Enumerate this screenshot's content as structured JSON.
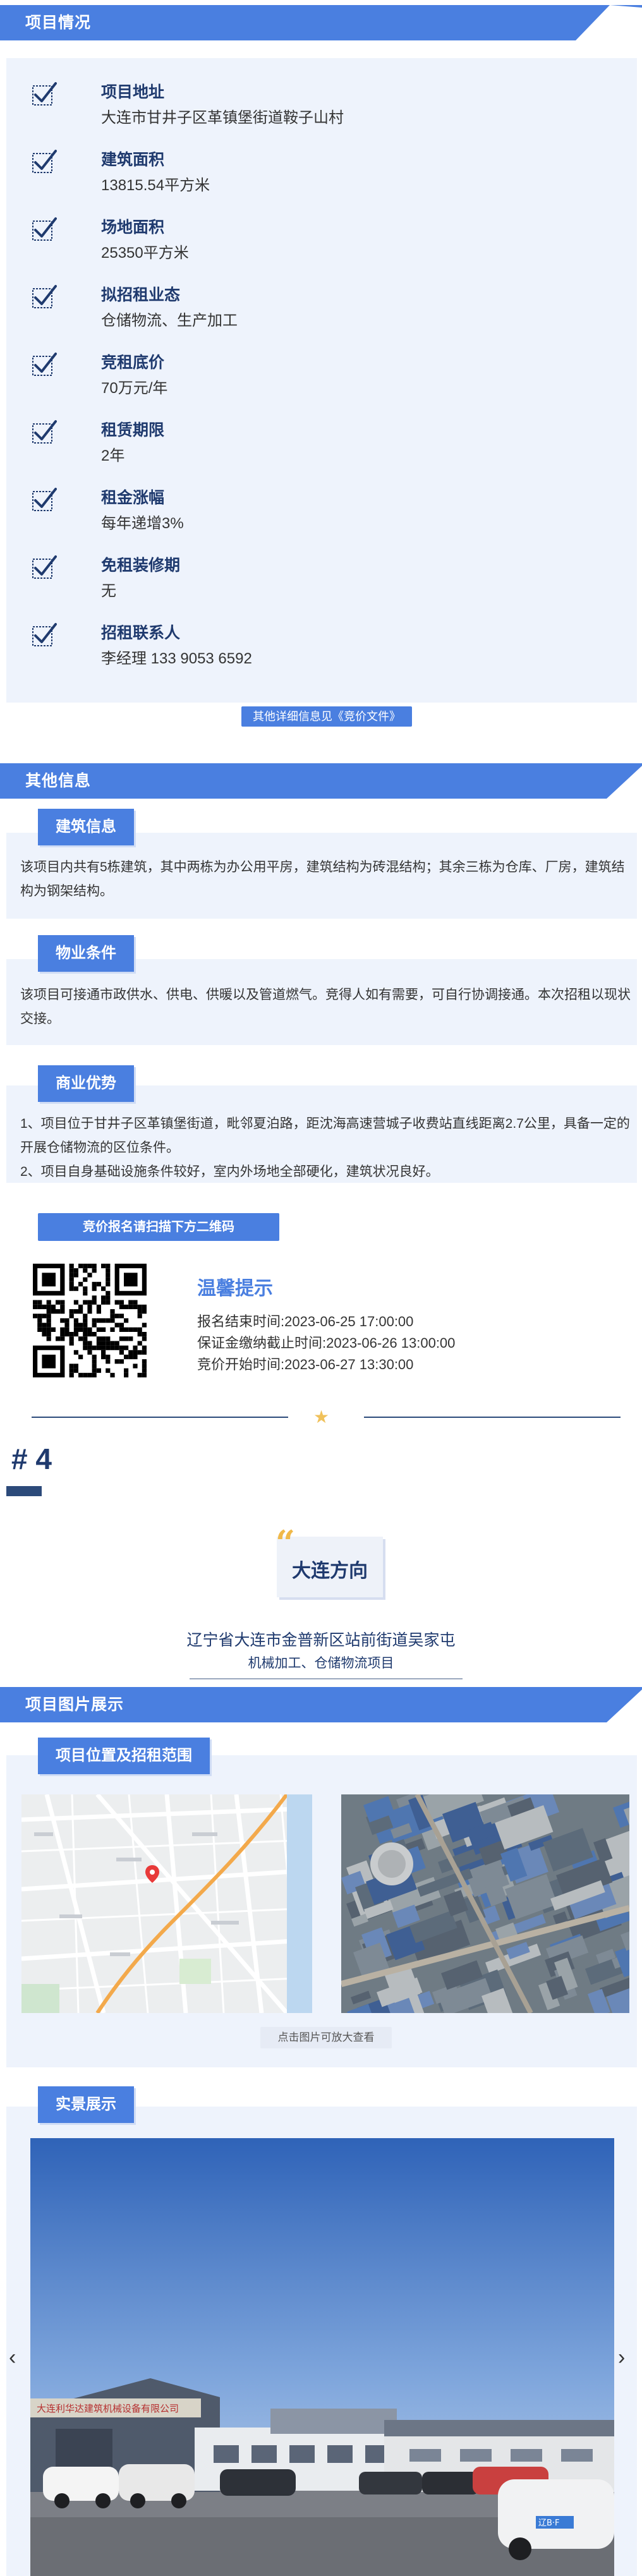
{
  "project_info": {
    "title": "项目情况",
    "items": [
      {
        "label": "项目地址",
        "value": "大连市甘井子区革镇堡街道鞍子山村"
      },
      {
        "label": "建筑面积",
        "value": "13815.54平方米"
      },
      {
        "label": "场地面积",
        "value": "25350平方米"
      },
      {
        "label": "拟招租业态",
        "value": "仓储物流、生产加工"
      },
      {
        "label": "竞租底价",
        "value": "70万元/年"
      },
      {
        "label": "租赁期限",
        "value": "2年"
      },
      {
        "label": "租金涨幅",
        "value": "每年递增3%"
      },
      {
        "label": "免租装修期",
        "value": "无"
      },
      {
        "label": "招租联系人",
        "value": "李经理 133 9053 6592"
      }
    ],
    "more_link": "其他详细信息见《竞价文件》"
  },
  "other_info": {
    "title": "其他信息",
    "building": {
      "tag": "建筑信息",
      "text": "该项目内共有5栋建筑，其中两栋为办公用平房，建筑结构为砖混结构；其余三栋为仓库、厂房，建筑结构为钢架结构。"
    },
    "property": {
      "tag": "物业条件",
      "text": "该项目可接通市政供水、供电、供暖以及管道燃气。竞得人如有需要，可自行协调接通。本次招租以现状交接。"
    },
    "advantage": {
      "tag": "商业优势",
      "line1": "1、项目位于甘井子区革镇堡街道，毗邻夏泊路，距沈海高速营城子收费站直线距离2.7公里，具备一定的开展仓储物流的区位条件。",
      "line2": "2、项目自身基础设施条件较好，室内外场地全部硬化，建筑状况良好。"
    },
    "qr_label": "竞价报名请扫描下方二维码",
    "reminder": {
      "title": "温馨提示",
      "lines": [
        "报名结束时间:2023-06-25 17:00:00",
        "保证金缴纳截止时间:2023-06-26 13:00:00",
        "竞价开始时间:2023-06-27 13:30:00"
      ]
    }
  },
  "project4": {
    "number": "# 4",
    "city": "大连方向",
    "address": "辽宁省大连市金普新区站前街道吴家屯",
    "usage": "机械加工、仓储物流项目"
  },
  "images": {
    "title": "项目图片展示",
    "location_tag": "项目位置及招租范围",
    "hint": "点击图片可放大查看",
    "real_tag": "实景展示",
    "signboard": "大连利华达建筑机械设备有限公司",
    "plate": "辽B·F"
  },
  "colors": {
    "accent": "#4a7fe0",
    "navy": "#1f3a6e",
    "panel": "#eef3fc",
    "star": "#f0c15a"
  },
  "icons": {
    "check": "check-box-icon",
    "prev": "chevron-left-icon",
    "next": "chevron-right-icon",
    "quote": "quote-icon",
    "star": "star-icon",
    "pin": "map-pin-icon"
  }
}
